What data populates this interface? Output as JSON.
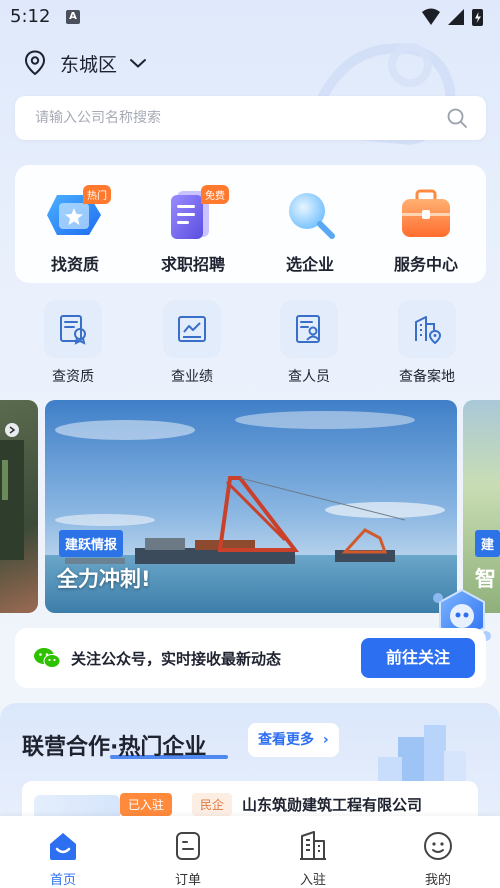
{
  "status_bar": {
    "time": "5:12",
    "notif_letter": "A"
  },
  "location": {
    "district": "东城区"
  },
  "search": {
    "placeholder": "请输入公司名称搜索"
  },
  "main_features": [
    {
      "label": "找资质",
      "tag": "热门",
      "icon": "qualification-icon"
    },
    {
      "label": "求职招聘",
      "tag": "免费",
      "icon": "document-icon"
    },
    {
      "label": "选企业",
      "tag": "",
      "icon": "magnifier-icon"
    },
    {
      "label": "服务中心",
      "tag": "",
      "icon": "briefcase-icon"
    }
  ],
  "sub_features": [
    {
      "label": "查资质",
      "icon": "certificate-icon"
    },
    {
      "label": "查业绩",
      "icon": "chart-icon"
    },
    {
      "label": "查人员",
      "icon": "person-card-icon"
    },
    {
      "label": "查备案地",
      "icon": "building-location-icon"
    }
  ],
  "banner": {
    "tag": "建跃情报",
    "title": "全力冲刺!",
    "right_tag": "建",
    "right_title": "智"
  },
  "follow": {
    "text": "关注公众号，实时接收最新动态",
    "button": "前往关注"
  },
  "hot": {
    "title": "联营合作·热门企业",
    "see_more": "查看更多",
    "company": {
      "joined": "已入驻",
      "type": "民企",
      "name": "山东筑勋建筑工程有限公司"
    }
  },
  "tabs": [
    {
      "label": "首页",
      "active": true
    },
    {
      "label": "订单",
      "active": false
    },
    {
      "label": "入驻",
      "active": false
    },
    {
      "label": "我的",
      "active": false
    }
  ],
  "colors": {
    "accent": "#2c6ff0",
    "orange": "#ff7a2e"
  }
}
